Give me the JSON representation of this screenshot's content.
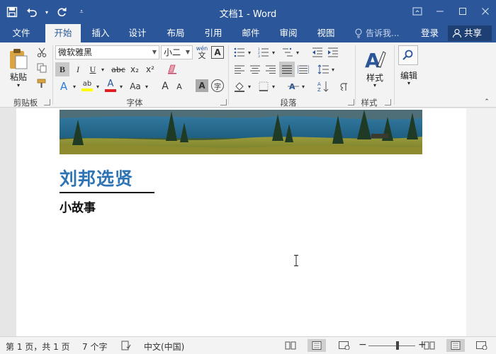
{
  "app": {
    "window_title": "文档1 - Word"
  },
  "quick_access": {
    "save_icon": "save-icon",
    "undo_icon": "undo-icon",
    "redo_icon": "redo-icon",
    "customize_icon": "customize-qat-icon"
  },
  "window_controls": [
    "ribbon-display-options-icon",
    "minimize-icon",
    "maximize-icon",
    "close-icon"
  ],
  "tabs": [
    {
      "label": "文件"
    },
    {
      "label": "开始",
      "active": true
    },
    {
      "label": "插入"
    },
    {
      "label": "设计"
    },
    {
      "label": "布局"
    },
    {
      "label": "引用"
    },
    {
      "label": "邮件"
    },
    {
      "label": "审阅"
    },
    {
      "label": "视图"
    }
  ],
  "tell_me": {
    "placeholder": "告诉我..."
  },
  "account": {
    "login": "登录",
    "share": "共享"
  },
  "ribbon": {
    "clipboard": {
      "label": "剪贴板",
      "paste": "粘贴"
    },
    "font": {
      "label": "字体",
      "font_name": "微软雅黑",
      "font_size": "小二",
      "bold": "B",
      "italic": "I",
      "underline": "U",
      "strikethrough": "abc",
      "subscript": "x₂",
      "superscript": "x²",
      "phonetic_top": "wén",
      "phonetic_bottom": "文",
      "char_border": "A",
      "grow": "A",
      "shrink": "A",
      "case": "Aa",
      "shading": "A",
      "enclose": "字",
      "font_color_letter": "A"
    },
    "paragraph": {
      "label": "段落"
    },
    "styles": {
      "label": "样式",
      "button": "样式"
    },
    "editing": {
      "button": "编辑"
    },
    "colors": {
      "highlight": "#ffff00",
      "font_color": "#e02020",
      "accent": "#2b579a"
    }
  },
  "document": {
    "heading": "刘邦选贤",
    "subheading": "小故事",
    "heading_color": "#2e74b5"
  },
  "status_bar": {
    "page_info": "第 1 页，共 1 页",
    "word_count": "7 个字",
    "language": "中文(中国)",
    "zoom_icon_out": "zoom-out-icon",
    "zoom_icon_in": "zoom-in-icon"
  }
}
